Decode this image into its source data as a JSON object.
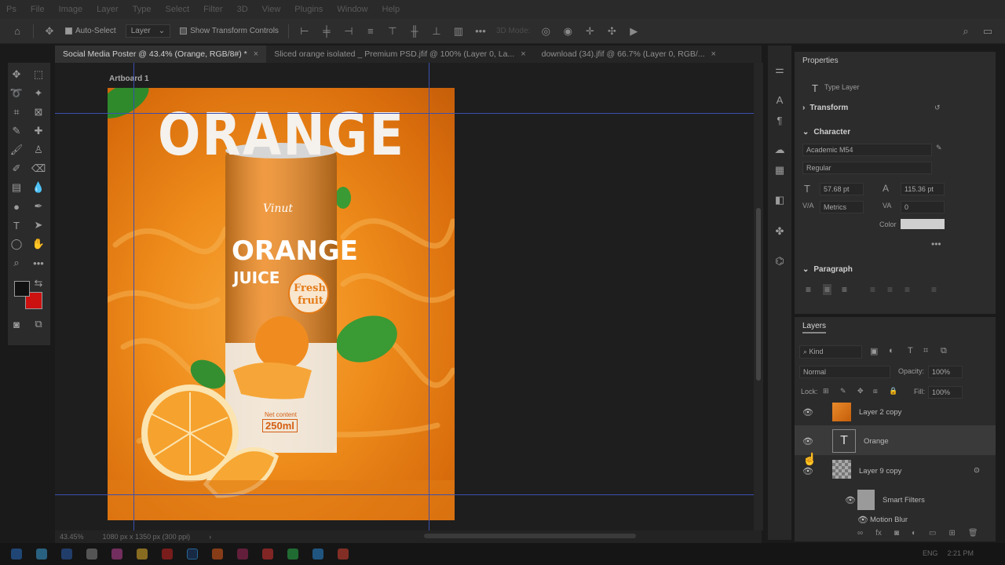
{
  "menu": [
    "Ps",
    "File",
    "Image",
    "Layer",
    "Type",
    "Select",
    "Filter",
    "3D",
    "View",
    "Plugins",
    "Window",
    "Help"
  ],
  "options": {
    "auto_select_label": "Auto-Select",
    "layer_dropdown": "Layer",
    "show_transform_label": "Show Transform Controls",
    "mode_3d": "3D Mode:"
  },
  "tabs": [
    {
      "label": "Social Media Poster @ 43.4% (Orange, RGB/8#) *",
      "active": true
    },
    {
      "label": "Sliced orange isolated _ Premium PSD.jfif @ 100% (Layer 0, La...",
      "active": false
    },
    {
      "label": "download (34).jfif @ 66.7% (Layer 0, RGB/...",
      "active": false
    }
  ],
  "canvas": {
    "artboard_label": "Artboard 1",
    "poster_headline": "ORANGE",
    "can_title": "ORANGE",
    "can_subtitle": "JUICE",
    "can_badge_1": "Fresh",
    "can_badge_2": "fruit",
    "can_net": "Net content",
    "can_volume": "250ml",
    "brand": "Vinut"
  },
  "status": {
    "zoom": "43.45%",
    "doc_size": "1080 px x 1350 px (300 ppi)"
  },
  "properties": {
    "title": "Properties",
    "layer_type": "Type Layer",
    "transform_label": "Transform",
    "character_label": "Character",
    "font_family": "Academic M54",
    "font_style": "Regular",
    "font_size": "57.68 pt",
    "leading": "115.36 pt",
    "kerning": "Metrics",
    "tracking": "0",
    "color_label": "Color",
    "paragraph_label": "Paragraph"
  },
  "layers": {
    "title": "Layers",
    "filter_kind": "Kind",
    "blend_mode": "Normal",
    "opacity_label": "Opacity:",
    "opacity_value": "100%",
    "lock_label": "Lock:",
    "fill_label": "Fill:",
    "fill_value": "100%",
    "rows": [
      {
        "name": "Layer 2 copy"
      },
      {
        "name": "Orange"
      },
      {
        "name": "Layer 9 copy"
      },
      {
        "name": "Smart Filters"
      },
      {
        "name": "Motion Blur"
      }
    ]
  },
  "taskbar": {
    "lang": "ENG",
    "time": "2:21 PM"
  },
  "colors": {
    "accent_guide": "#3a4fb0",
    "foreground": "#111111",
    "background": "#cc1111"
  }
}
